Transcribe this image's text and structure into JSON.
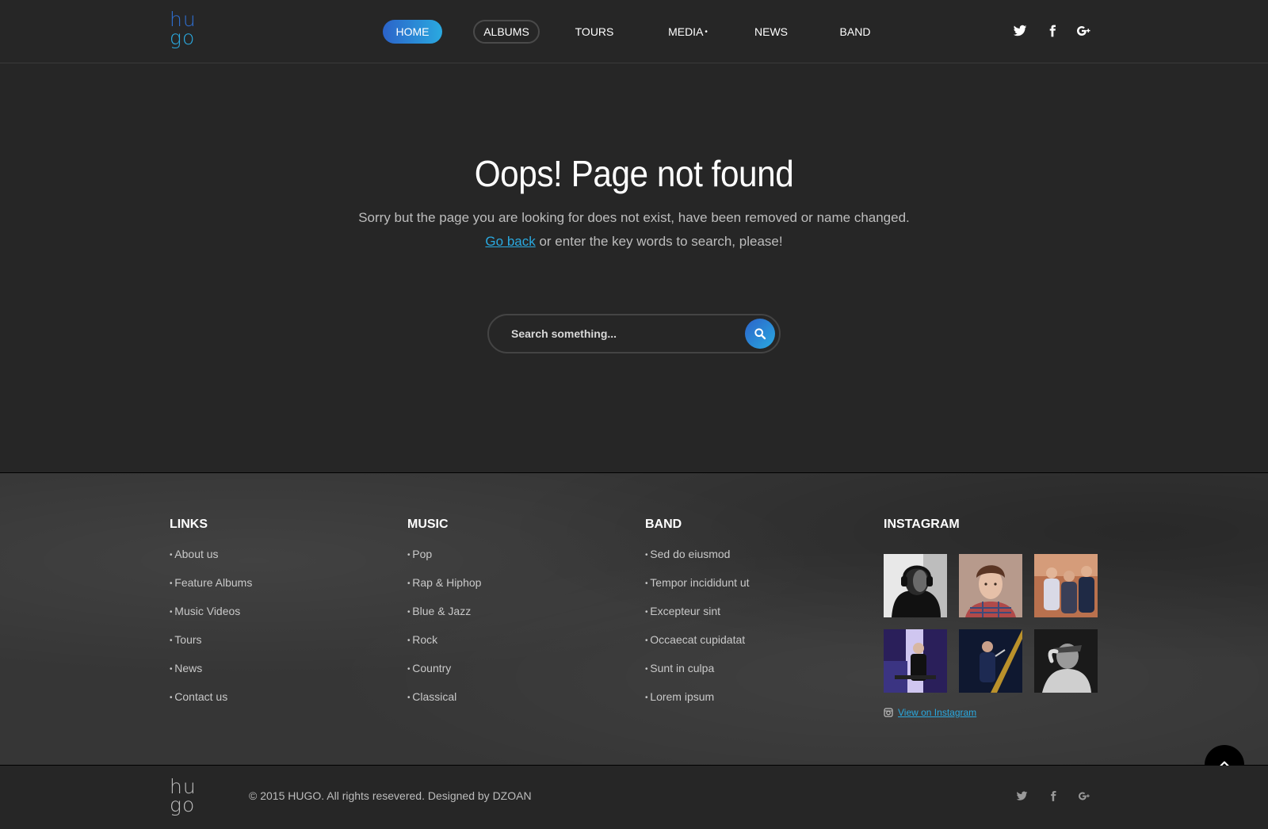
{
  "header": {
    "logo_top": "hu",
    "logo_bottom": "go",
    "nav": {
      "home": "HOME",
      "albums": "ALBUMS",
      "tours": "TOURS",
      "media": "MEDIA",
      "news": "NEWS",
      "band": "BAND"
    },
    "social": [
      "twitter-icon",
      "facebook-icon",
      "google-plus-icon"
    ]
  },
  "main": {
    "title": "Oops! Page not found",
    "line1": "Sorry but the page you are looking for does not exist, have been removed or name changed.",
    "go_back": "Go back",
    "line2_rest": "or enter the key words to search, please!",
    "search_placeholder": "Search something..."
  },
  "footer": {
    "links": {
      "title": "LINKS",
      "items": [
        "About us",
        "Feature Albums",
        "Music Videos",
        "Tours",
        "News",
        "Contact us"
      ]
    },
    "music": {
      "title": "MUSIC",
      "items": [
        "Pop",
        "Rap & Hiphop",
        "Blue & Jazz",
        "Rock",
        "Country",
        "Classical"
      ]
    },
    "band": {
      "title": "BAND",
      "items": [
        "Sed do eiusmod",
        "Tempor incididunt ut",
        "Excepteur sint",
        "Occaecat cupidatat",
        "Sunt in culpa",
        "Lorem ipsum"
      ]
    },
    "instagram": {
      "title": "INSTAGRAM",
      "link": "View on Instagram"
    }
  },
  "bottom": {
    "logo_top": "hu",
    "logo_bottom": "go",
    "copyright": "© 2015 HUGO. All rights resevered. Designed by DZOAN"
  },
  "colors": {
    "accent_start": "#2b63c9",
    "accent_end": "#2aa9e0",
    "background": "#262626"
  }
}
